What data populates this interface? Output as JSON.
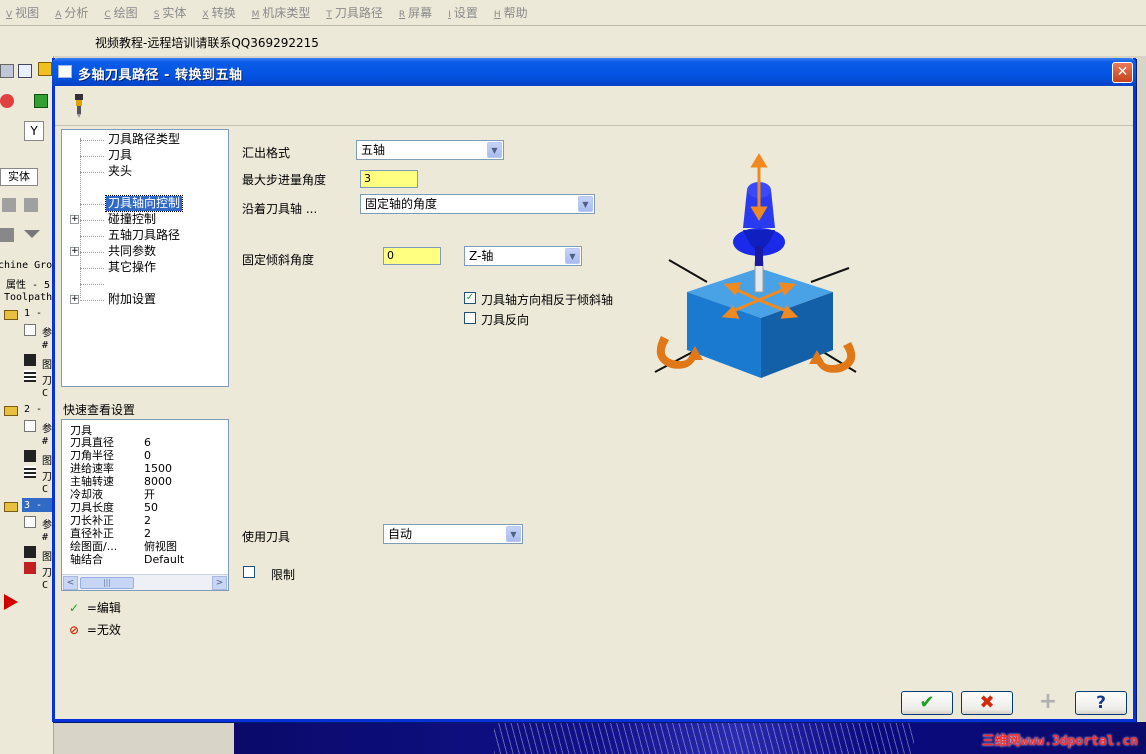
{
  "menubar": {
    "items": [
      {
        "key": "V",
        "label": "视图"
      },
      {
        "key": "A",
        "label": "分析"
      },
      {
        "key": "C",
        "label": "绘图"
      },
      {
        "key": "S",
        "label": "实体"
      },
      {
        "key": "X",
        "label": "转换"
      },
      {
        "key": "M",
        "label": "机床类型"
      },
      {
        "key": "T",
        "label": "刀具路径"
      },
      {
        "key": "R",
        "label": "屏幕"
      },
      {
        "key": "I",
        "label": "设置"
      },
      {
        "key": "H",
        "label": "帮助"
      }
    ]
  },
  "notice": "视频教程-远程培训请联系QQ369292215",
  "left_strip": {
    "y_box": "Y",
    "tab_solid": "实体",
    "lines": [
      "chine Gro",
      "属性 - 5",
      "Toolpath",
      "1 - ",
      "参",
      "#",
      "图",
      "刀",
      "C",
      "2 - ",
      "参",
      "#",
      "图",
      "刀",
      "C",
      "3 - ",
      "参",
      "#",
      "图",
      "刀",
      "C"
    ]
  },
  "dialog": {
    "title": "多轴刀具路径 - 转换到五轴",
    "close_label": "✕",
    "tree": {
      "items": [
        {
          "label": "刀具路径类型",
          "expander": ""
        },
        {
          "label": "刀具",
          "expander": ""
        },
        {
          "label": "夹头",
          "expander": ""
        },
        {
          "label": "刀具轴向控制",
          "expander": "",
          "selected": true
        },
        {
          "label": "碰撞控制",
          "expander": "+"
        },
        {
          "label": "五轴刀具路径",
          "expander": ""
        },
        {
          "label": "共同参数",
          "expander": "+"
        },
        {
          "label": "其它操作",
          "expander": ""
        },
        {
          "label": "附加设置",
          "expander": "+"
        }
      ]
    },
    "quickview": {
      "title": "快速查看设置",
      "header": "刀具",
      "rows": [
        {
          "label": "刀具直径",
          "value": "6"
        },
        {
          "label": "刀角半径",
          "value": "0"
        },
        {
          "label": "进给速率",
          "value": "1500"
        },
        {
          "label": "主轴转速",
          "value": "8000"
        },
        {
          "label": "冷却液",
          "value": "开"
        },
        {
          "label": "刀具长度",
          "value": "50"
        },
        {
          "label": "刀长补正",
          "value": "2"
        },
        {
          "label": "直径补正",
          "value": "2"
        },
        {
          "label": "绘图面/...",
          "value": "俯视图"
        },
        {
          "label": "轴结合",
          "value": "Default"
        }
      ],
      "scroll_left": "<",
      "scroll_right": ">",
      "scroll_thumb": "|||"
    },
    "legend": {
      "edit_icon": "✓",
      "edit_label": "=编辑",
      "invalid_icon": "⊘",
      "invalid_label": "=无效"
    },
    "form": {
      "output_format_label": "汇出格式",
      "output_format_value": "五轴",
      "max_step_label": "最大步进量角度",
      "max_step_value": "3",
      "along_axis_label": "沿着刀具轴 ...",
      "along_axis_value": "固定轴的角度",
      "fixed_tilt_label": "固定倾斜角度",
      "fixed_tilt_value": "0",
      "axis_select_value": "Z-轴",
      "reverse_tilt_label": "刀具轴方向相反于倾斜轴",
      "reverse_tilt_checked": true,
      "tool_reverse_label": "刀具反向",
      "tool_reverse_checked": false,
      "use_tool_label": "使用刀具",
      "use_tool_value": "自动",
      "limit_label": "限制",
      "limit_checked": false
    },
    "buttons": {
      "ok": "✔",
      "cancel": "✖",
      "add": "+",
      "help": "?"
    }
  },
  "watermark": "三维网www.3dportal.cn",
  "colors": {
    "titlebar": "#0554e3",
    "selection": "#316ac5",
    "input_yellow": "#ffff80",
    "ok_green": "#21a121",
    "cancel_red": "#d42a0a",
    "cube_blue": "#1a7ad0",
    "spindle_blue": "#1a2ae8",
    "arrow_orange": "#f08a20"
  }
}
